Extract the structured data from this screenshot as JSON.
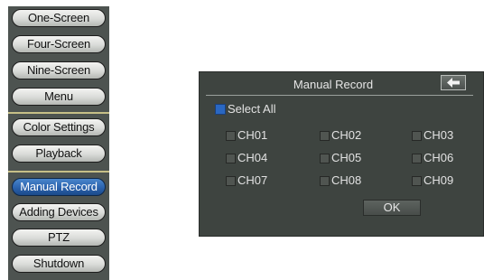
{
  "menu": {
    "one_screen": "One-Screen",
    "four_screen": "Four-Screen",
    "nine_screen": "Nine-Screen",
    "menu": "Menu",
    "color_settings": "Color Settings",
    "playback": "Playback",
    "manual_record": "Manual Record",
    "adding_devices": "Adding Devices",
    "ptz": "PTZ",
    "shutdown": "Shutdown"
  },
  "dialog": {
    "title": "Manual Record",
    "select_all": "Select All",
    "select_all_checked": true,
    "ok": "OK",
    "channels": [
      "CH01",
      "CH02",
      "CH03",
      "CH04",
      "CH05",
      "CH06",
      "CH07",
      "CH08",
      "CH09"
    ]
  },
  "colors": {
    "active_button": "#2a62ad",
    "dialog_bg": "#3e4440",
    "menu_bg": "#4d5350",
    "separator": "#c6bf87"
  },
  "icons": {
    "back": "back-arrow-icon"
  }
}
